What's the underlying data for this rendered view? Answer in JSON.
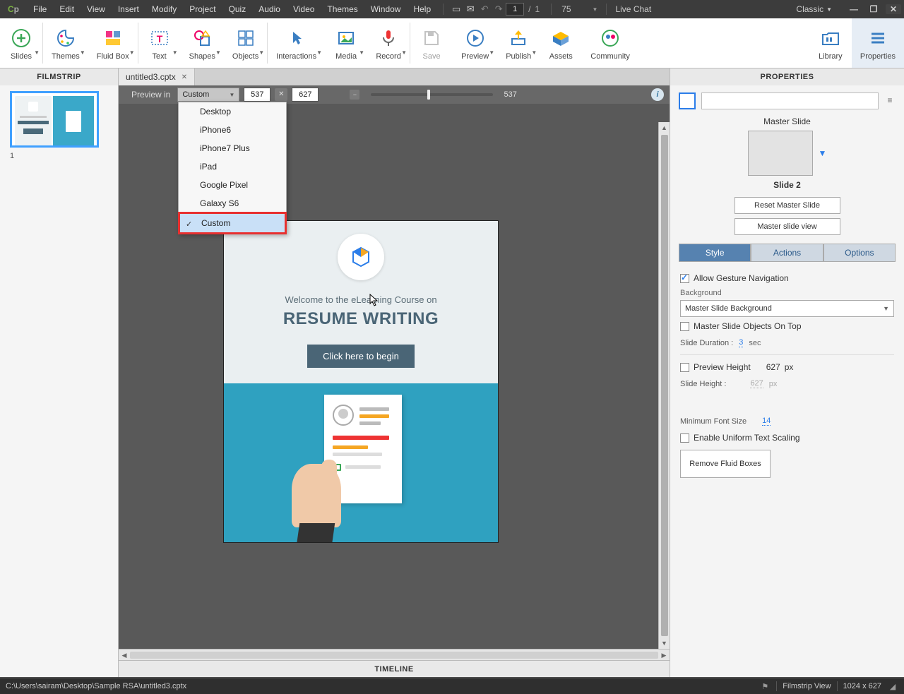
{
  "menubar": {
    "items": [
      "File",
      "Edit",
      "View",
      "Insert",
      "Modify",
      "Project",
      "Quiz",
      "Audio",
      "Video",
      "Themes",
      "Window",
      "Help"
    ],
    "page_current": "1",
    "page_total": "1",
    "zoom_val": "75",
    "live_chat": "Live Chat",
    "workspace": "Classic"
  },
  "ribbon": {
    "items": [
      {
        "label": "Slides",
        "icon": "plus",
        "dd": true
      },
      {
        "label": "Themes",
        "icon": "palette",
        "dd": true
      },
      {
        "label": "Fluid Box",
        "icon": "grid",
        "dd": true
      },
      {
        "label": "Text",
        "icon": "text",
        "dd": true
      },
      {
        "label": "Shapes",
        "icon": "shapes",
        "dd": true
      },
      {
        "label": "Objects",
        "icon": "objects",
        "dd": true
      },
      {
        "label": "Interactions",
        "icon": "pointer",
        "dd": true
      },
      {
        "label": "Media",
        "icon": "image",
        "dd": true
      },
      {
        "label": "Record",
        "icon": "mic",
        "dd": true
      },
      {
        "label": "Save",
        "icon": "save",
        "dd": false,
        "disabled": true
      },
      {
        "label": "Preview",
        "icon": "play",
        "dd": true
      },
      {
        "label": "Publish",
        "icon": "upload",
        "dd": true
      },
      {
        "label": "Assets",
        "icon": "assets",
        "dd": false
      },
      {
        "label": "Community",
        "icon": "community",
        "dd": false
      },
      {
        "label": "Library",
        "icon": "library",
        "dd": false
      },
      {
        "label": "Properties",
        "icon": "properties",
        "dd": false
      }
    ]
  },
  "panels": {
    "filmstrip": "Filmstrip",
    "properties": "Properties",
    "timeline": "Timeline"
  },
  "doctab": {
    "name": "untitled3.cptx"
  },
  "filmstrip": {
    "slide_num": "1"
  },
  "canvas_toolbar": {
    "preview_in": "Preview in",
    "selected": "Custom",
    "width": "537",
    "height": "627",
    "slider_val": "537"
  },
  "preview_dropdown": {
    "items": [
      "Desktop",
      "iPhone6",
      "iPhone7 Plus",
      "iPad",
      "Google Pixel",
      "Galaxy S6",
      "Custom"
    ],
    "selected_index": 6
  },
  "slide": {
    "welcome": "Welcome to the eLearning Course on",
    "heading": "RESUME WRITING",
    "button": "Click here to begin"
  },
  "properties": {
    "master_slide_label": "Master Slide",
    "master_name": "Slide 2",
    "reset_btn": "Reset Master Slide",
    "view_btn": "Master slide view",
    "tabs": [
      "Style",
      "Actions",
      "Options"
    ],
    "allow_gesture": "Allow Gesture Navigation",
    "background_label": "Background",
    "background_value": "Master Slide Background",
    "objects_on_top": "Master Slide Objects On Top",
    "duration_label": "Slide Duration :",
    "duration_val": "3",
    "duration_unit": "sec",
    "preview_h_label": "Preview Height",
    "preview_h_val": "627",
    "slide_h_label": "Slide Height :",
    "slide_h_val": "627",
    "px": "px",
    "min_font_label": "Minimum Font Size",
    "min_font_val": "14",
    "uniform_scaling": "Enable Uniform Text Scaling",
    "remove_fluid": "Remove Fluid Boxes"
  },
  "statusbar": {
    "path": "C:\\Users\\sairam\\Desktop\\Sample RSA\\untitled3.cptx",
    "view": "Filmstrip View",
    "dims": "1024 x 627"
  }
}
